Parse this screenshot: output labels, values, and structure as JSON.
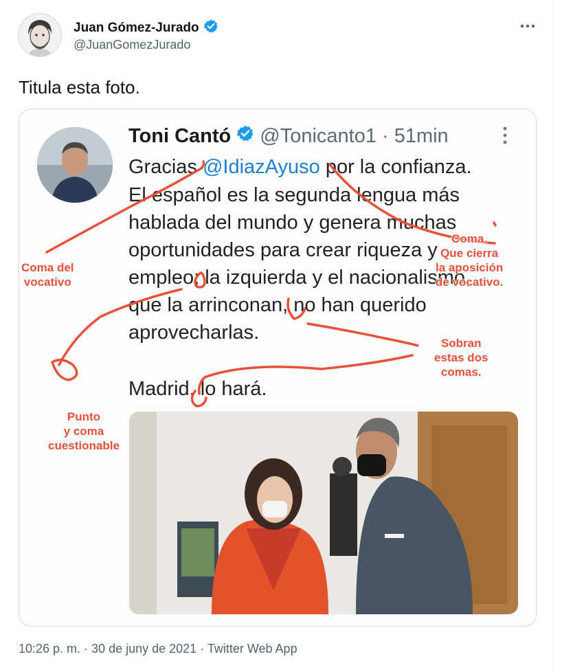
{
  "author": {
    "name": "Juan Gómez-Jurado",
    "handle": "@JuanGomezJurado"
  },
  "tweet": {
    "text": "Titula esta foto."
  },
  "footer": {
    "text": "10:26 p. m. · 30 de juny de 2021 · Twitter Web App"
  },
  "embedded": {
    "name": "Toni Cantó",
    "handle": "@Tonicanto1",
    "sep_time": "· 51min",
    "lines": [
      {
        "before": "Gracias ",
        "mention": "@IdiazAyuso",
        "after": " por la confianza."
      },
      {
        "text": "El español es la segunda lengua más"
      },
      {
        "text": "hablada del mundo y genera muchas"
      },
      {
        "text": "oportunidades para crear riqueza y"
      },
      {
        "text": "empleo; la izquierda y el nacionalismo,"
      },
      {
        "text": "que la arrinconan, no han querido"
      },
      {
        "text": "aprovecharlas."
      },
      {
        "text": "Madrid, lo hará."
      }
    ]
  },
  "annotations": {
    "coma_vocativo": [
      "Coma del",
      "vocativo"
    ],
    "coma_cierra": [
      "Coma.",
      "Que cierra",
      "la aposición",
      "de vocativo."
    ],
    "sobran": [
      "Sobran",
      "estas dos",
      "comas."
    ],
    "punto_coma": [
      "Punto",
      "y coma",
      "cuestionable"
    ]
  },
  "colors": {
    "verified": "#1d9bf0",
    "annotation": "#e8503a",
    "mention": "#1d7ed3"
  },
  "icons": {
    "verified": "verified-badge-icon",
    "more": "more-horizontal-icon"
  }
}
